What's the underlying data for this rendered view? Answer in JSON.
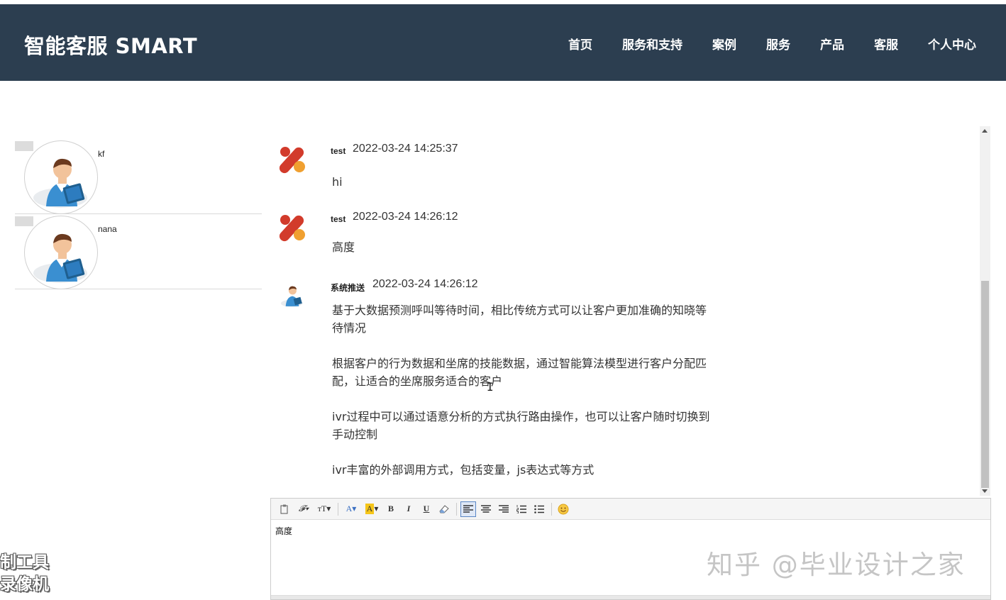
{
  "header": {
    "brand": "智能客服 SMART",
    "nav": [
      "首页",
      "服务和支持",
      "案例",
      "服务",
      "产品",
      "客服",
      "个人中心"
    ]
  },
  "contacts": [
    {
      "name": "kf"
    },
    {
      "name": "nana"
    }
  ],
  "messages": [
    {
      "sender": "test",
      "time": "2022-03-24 14:25:37",
      "body": [
        "hi"
      ],
      "avatar": "brand-logo-icon"
    },
    {
      "sender": "test",
      "time": "2022-03-24 14:26:12",
      "body": [
        "高度"
      ],
      "avatar": "brand-logo-icon"
    },
    {
      "sender": "系统推送",
      "time": "2022-03-24 14:26:12",
      "avatar": "reader-avatar-icon",
      "body": [
        "基于大数据预测呼叫等待时间，相比传统方式可以让客户更加准确的知晓等待情况",
        "根据客户的行为数据和坐席的技能数据，通过智能算法模型进行客户分配匹配，让适合的坐席服务适合的客户",
        "ivr过程中可以通过语意分析的方式执行路由操作，也可以让客户随时切换到手动控制",
        "ivr丰富的外部调用方式，包括变量，js表达式等方式"
      ]
    }
  ],
  "editor": {
    "content": "高度",
    "toolbar": [
      "paste-icon",
      "font-family-icon",
      "font-size-icon",
      "font-color-icon",
      "highlight-icon",
      "bold-icon",
      "italic-icon",
      "underline-icon",
      "eraser-icon",
      "align-left-icon",
      "align-center-icon",
      "align-right-icon",
      "ordered-list-icon",
      "unordered-list-icon",
      "emoji-icon"
    ]
  },
  "overlay": {
    "watermark": "知乎 @毕业设计之家",
    "recorder_line1": "制工具",
    "recorder_line2": "录像机"
  },
  "colors": {
    "navbar": "#2c3e50",
    "logo_red": "#d23b2b",
    "logo_orange": "#f0a030"
  }
}
